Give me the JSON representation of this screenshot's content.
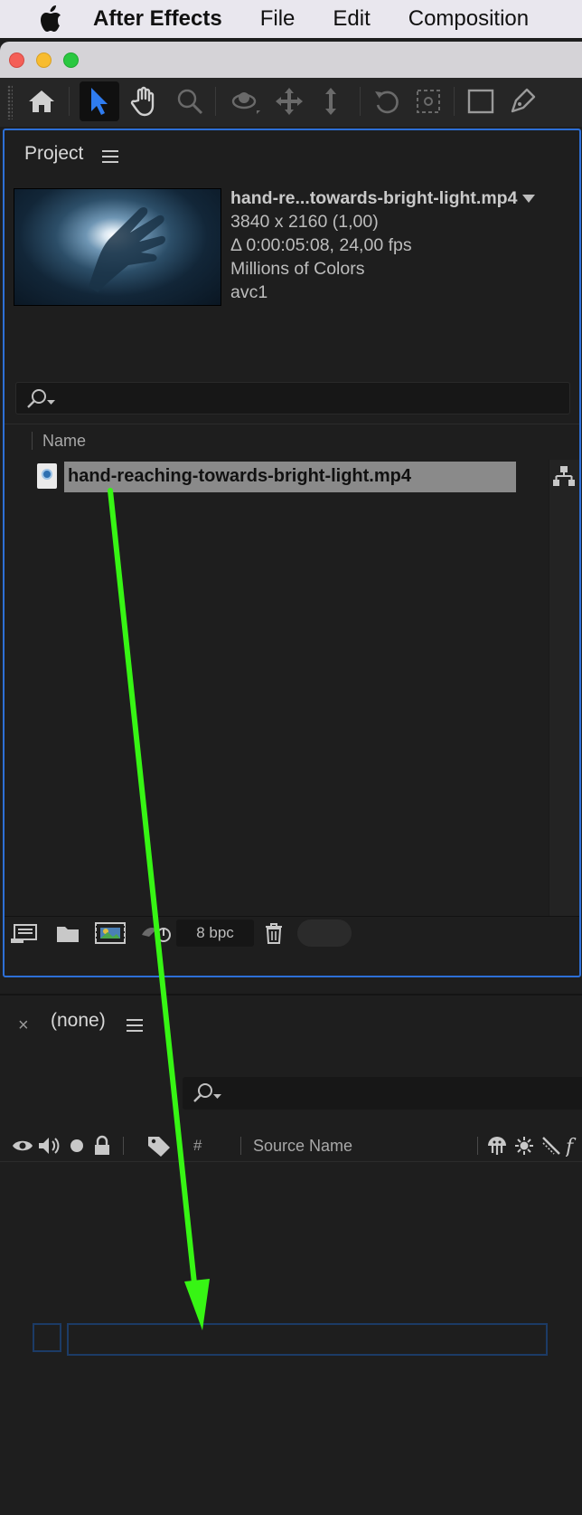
{
  "menubar": {
    "app_name": "After Effects",
    "items": [
      "File",
      "Edit",
      "Composition"
    ]
  },
  "project_panel": {
    "tab_label": "Project",
    "preview": {
      "file_name": "hand-re...towards-bright-light.mp4",
      "dimensions": "3840 x 2160 (1,00)",
      "duration": "Δ 0:00:05:08, 24,00 fps",
      "colors": "Millions of Colors",
      "codec": "avc1"
    },
    "search_placeholder": "",
    "column_name": "Name",
    "items": [
      {
        "name": "hand-reaching-towards-bright-light.mp4",
        "selected": true
      }
    ],
    "bit_depth": "8 bpc"
  },
  "timeline_panel": {
    "close_glyph": "×",
    "title": "(none)",
    "column_num": "#",
    "column_source": "Source Name"
  },
  "colors": {
    "accent_blue": "#2d6fd6",
    "drag_arrow": "#37f514",
    "selection_gray": "#8a8a8a"
  }
}
